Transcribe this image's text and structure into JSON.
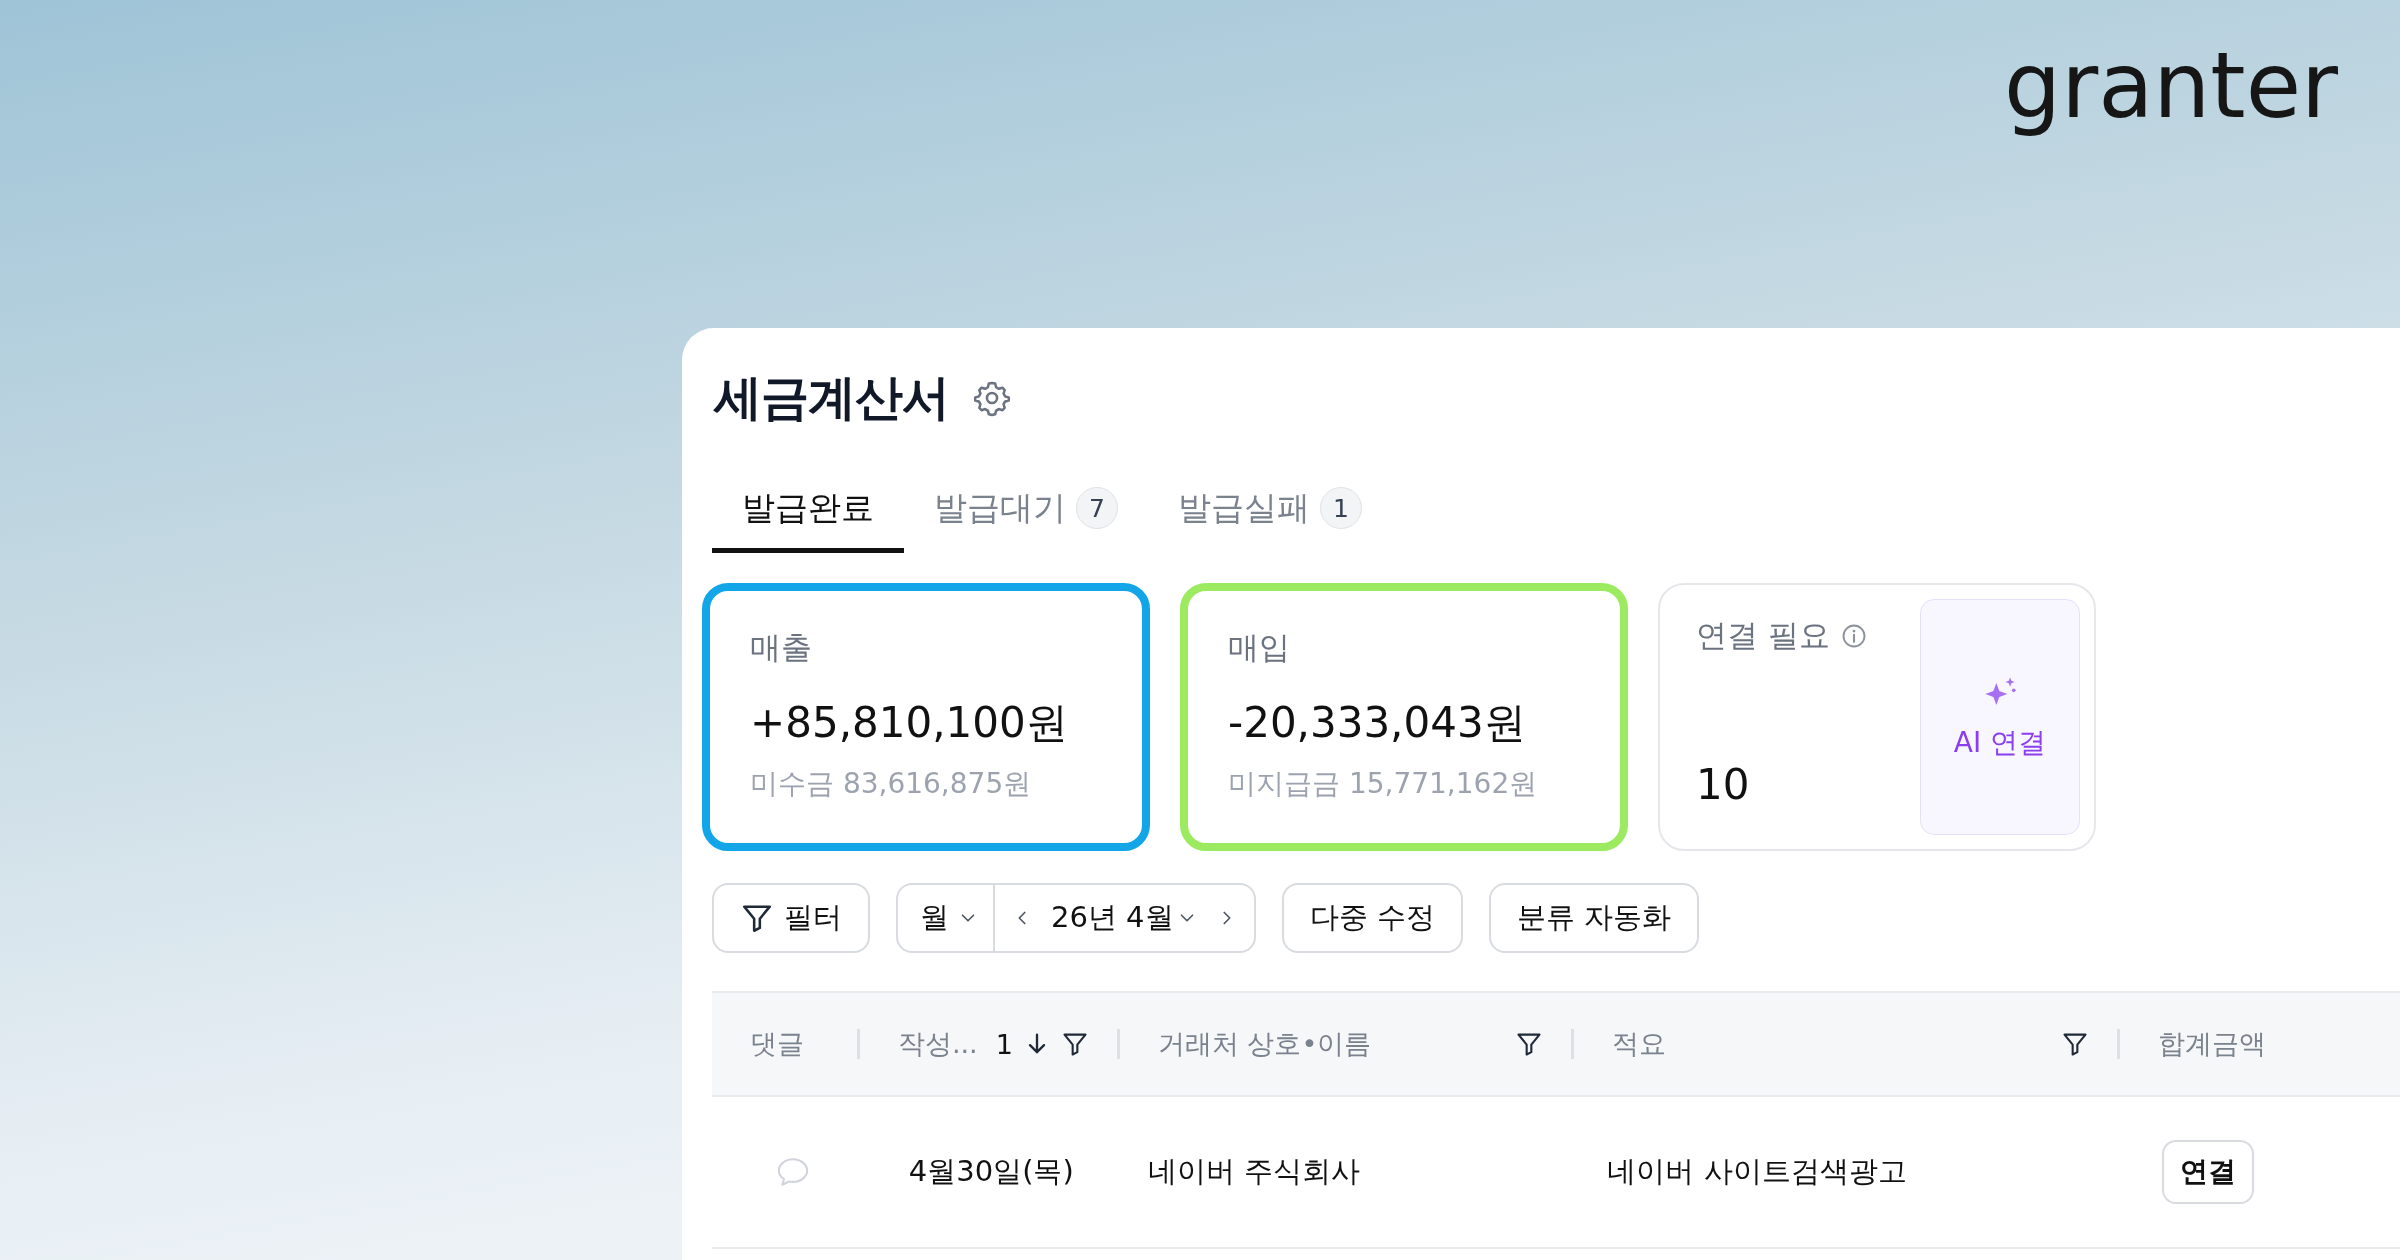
{
  "logo": {
    "text": "granter"
  },
  "page": {
    "title": "세금계산서"
  },
  "tabs": [
    {
      "label": "발급완료",
      "selected": true
    },
    {
      "label": "발급대기",
      "count": "7",
      "selected": false
    },
    {
      "label": "발급실패",
      "count": "1",
      "selected": false
    }
  ],
  "summary": [
    {
      "kind": "amount",
      "label": "매출",
      "amount": "+85,810,100원",
      "sub": "미수금 83,616,875원",
      "color": "#12a6e8"
    },
    {
      "kind": "amount",
      "label": "매입",
      "amount": "-20,333,043원",
      "sub": "미지급금 15,771,162원",
      "color": "#9bea5f"
    },
    {
      "kind": "count",
      "label": "연결 필요",
      "value": "10",
      "action": "AI 연결"
    }
  ],
  "toolbar": {
    "filter": "필터",
    "period": "월",
    "date": "26년 4월",
    "buttons": [
      "다중 수정",
      "분류 자동화"
    ]
  },
  "table": {
    "columns": [
      {
        "label": "댓글",
        "filter": false,
        "sorted": false
      },
      {
        "label": "작성...",
        "sort_rank": "1",
        "filter": true,
        "sorted": true
      },
      {
        "label": "거래처 상호•이름",
        "filter": true,
        "sorted": false
      },
      {
        "label": "적요",
        "filter": true,
        "sorted": false
      },
      {
        "label": "합계금액",
        "filter": false,
        "sorted": false
      }
    ],
    "rows": [
      {
        "date": "4월30일(목)",
        "partner": "네이버 주식회사",
        "memo": "네이버 사이트검색광고",
        "action": "연결"
      }
    ]
  }
}
